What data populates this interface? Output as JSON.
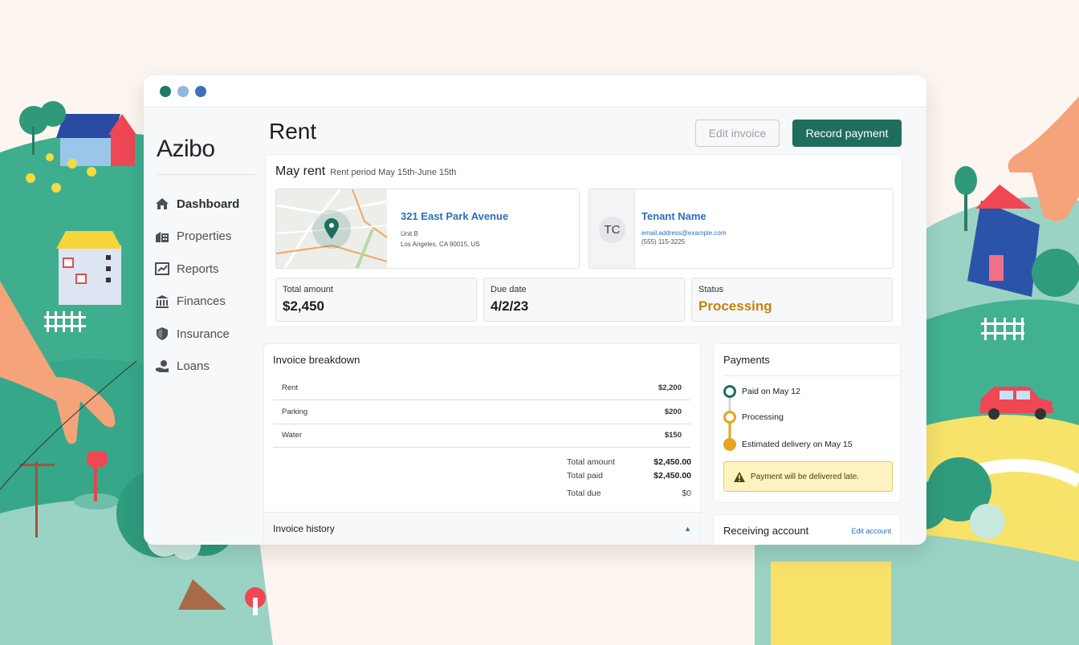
{
  "app": {
    "logo": "Azibo",
    "window_dots": [
      "#1f7a64",
      "#8fb7e0",
      "#3f6fb8"
    ]
  },
  "sidebar": {
    "items": [
      {
        "label": "Dashboard",
        "icon": "home-icon",
        "active": true
      },
      {
        "label": "Properties",
        "icon": "buildings-icon",
        "active": false
      },
      {
        "label": "Reports",
        "icon": "chart-icon",
        "active": false
      },
      {
        "label": "Finances",
        "icon": "bank-icon",
        "active": false
      },
      {
        "label": "Insurance",
        "icon": "shield-icon",
        "active": false
      },
      {
        "label": "Loans",
        "icon": "hand-coin-icon",
        "active": false
      }
    ]
  },
  "header": {
    "title": "Rent",
    "edit_label": "Edit invoice",
    "record_label": "Record payment"
  },
  "invoice": {
    "title": "May rent",
    "period": "Rent period May 15th-June 15th",
    "property": {
      "address": "321 East Park Avenue",
      "unit": "Unit B",
      "city": "Los Angeles, CA 90015, US"
    },
    "tenant": {
      "initials": "TC",
      "name": "Tenant Name",
      "email": "email.address@example.com",
      "phone": "(555) 115-3225"
    },
    "stats": {
      "total_label": "Total amount",
      "total_value": "$2,450",
      "due_label": "Due date",
      "due_value": "4/2/23",
      "status_label": "Status",
      "status_value": "Processing"
    }
  },
  "breakdown": {
    "title": "Invoice breakdown",
    "rows": [
      {
        "label": "Rent",
        "amount": "$2,200"
      },
      {
        "label": "Parking",
        "amount": "$200"
      },
      {
        "label": "Water",
        "amount": "$150"
      }
    ],
    "totals": {
      "total_amount_label": "Total amount",
      "total_amount": "$2,450.00",
      "total_paid_label": "Total paid",
      "total_paid": "$2,450.00",
      "total_due_label": "Total due",
      "total_due": "$0"
    },
    "history_label": "Invoice history"
  },
  "payments": {
    "title": "Payments",
    "steps": [
      {
        "label": "Paid on May 12"
      },
      {
        "label": "Processing"
      },
      {
        "label": "Estimated delivery on May 15"
      }
    ],
    "warning": "Payment will be delivered late."
  },
  "receiving": {
    "title": "Receiving account",
    "edit_label": "Edit account"
  },
  "colors": {
    "brand": "#1f6e5d",
    "link": "#2a6fbd",
    "processing": "#c58210",
    "paid": "#1f6e5d"
  }
}
